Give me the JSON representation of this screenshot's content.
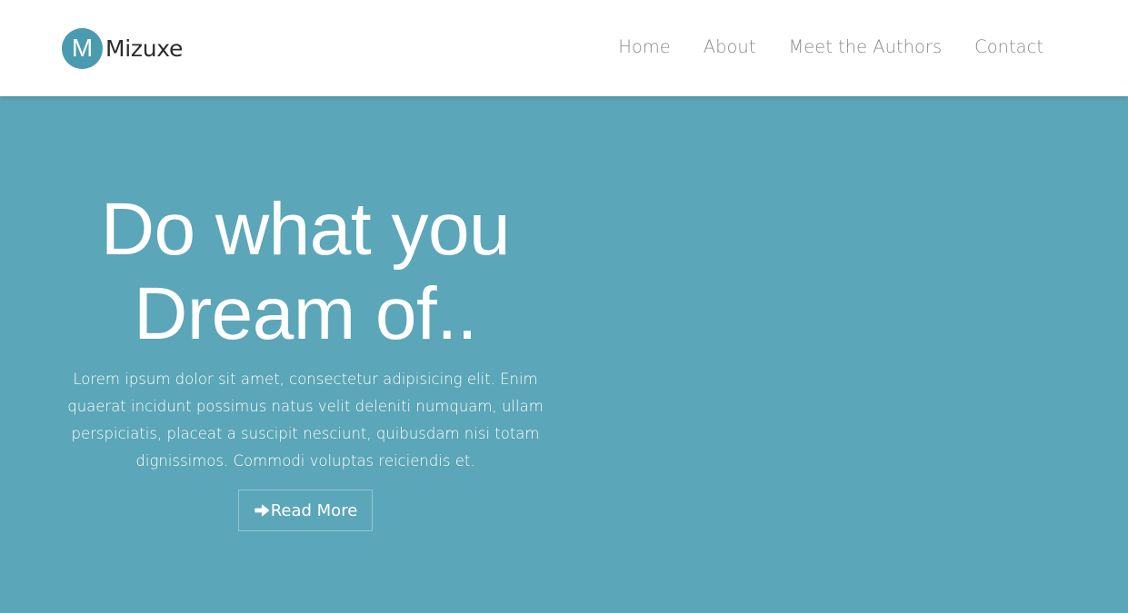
{
  "brand": {
    "logo_letter": "M",
    "name": "Mizuxe"
  },
  "nav": {
    "items": [
      "Home",
      "About",
      "Meet the Authors",
      "Contact"
    ]
  },
  "hero": {
    "title_line1": "Do what you",
    "title_line2": "Dream of..",
    "text": "Lorem ipsum dolor sit amet, consectetur adipisicing elit. Enim quaerat incidunt possimus natus velit deleniti numquam, ullam perspiciatis, placeat a suscipit nesciunt, quibusdam nisi totam dignissimos. Commodi voluptas reiciendis et.",
    "button_label": "Read More",
    "button_icon": "arrow-right-icon"
  },
  "colors": {
    "brand_accent": "#4a9bb0",
    "hero_background": "#5ba6b8",
    "nav_text": "#8a8a8a"
  }
}
